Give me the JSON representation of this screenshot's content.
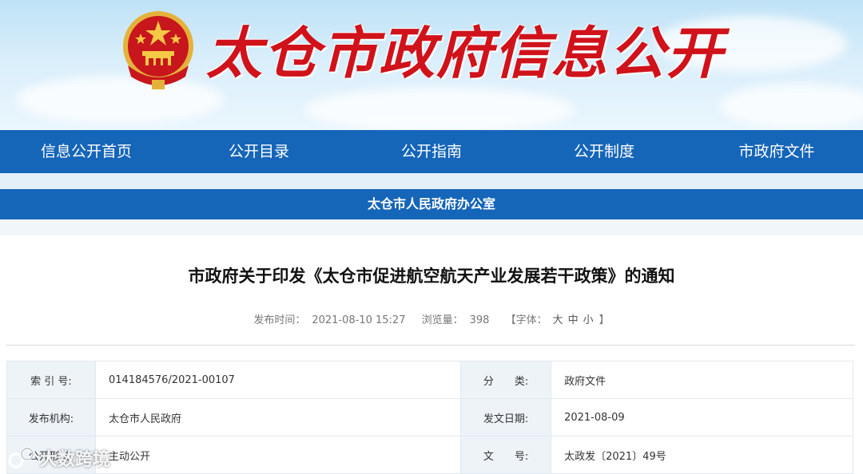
{
  "header": {
    "site_title": "太仓市政府信息公开"
  },
  "nav": {
    "items": [
      {
        "label": "信息公开首页"
      },
      {
        "label": "公开目录"
      },
      {
        "label": "公开指南"
      },
      {
        "label": "公开制度"
      },
      {
        "label": "市政府文件"
      }
    ]
  },
  "subheader": {
    "label": "太仓市人民政府办公室"
  },
  "article": {
    "title": "市政府关于印发《太仓市促进航空航天产业发展若干政策》的通知",
    "meta": {
      "publish_label": "发布时间：",
      "publish_time": "2021-08-10 15:27",
      "views_label": "浏览量：",
      "views": "398",
      "font_open": "【字体：",
      "font_large": "大",
      "font_medium": "中",
      "font_small": "小",
      "font_close": "】"
    }
  },
  "info_table": {
    "rows": [
      {
        "label1": "索 引 号:",
        "value1": "014184576/2021-00107",
        "label2": "分　　类:",
        "value2": "政府文件"
      },
      {
        "label1": "发布机构:",
        "value1": "太仓市人民政府",
        "label2": "发文日期:",
        "value2": "2021-08-09"
      },
      {
        "label1": "公开形式:",
        "value1": "主动公开",
        "label2": "文　　号:",
        "value2": "太政发〔2021〕49号"
      }
    ]
  },
  "watermark": {
    "text": "大数跨境"
  },
  "colors": {
    "nav_blue": "#1565b9",
    "title_red": "#d0121b",
    "label_bg": "#eef3f8"
  }
}
